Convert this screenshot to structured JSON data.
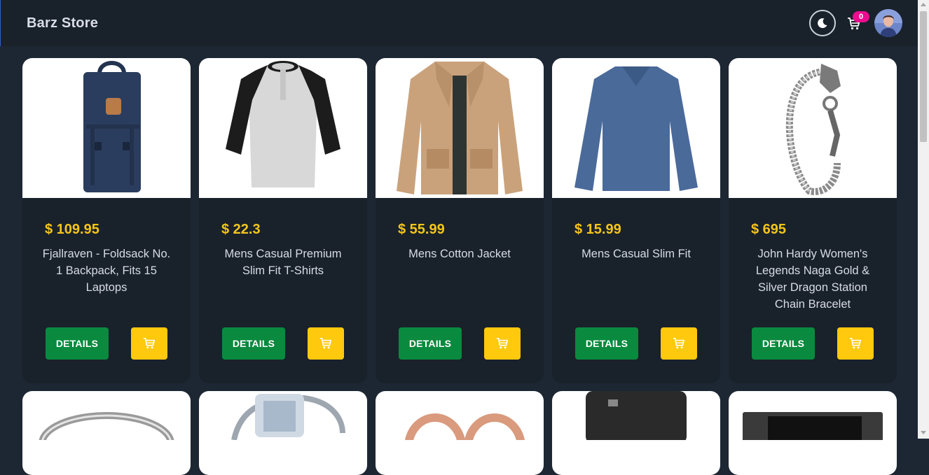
{
  "header": {
    "brand": "Barz Store",
    "cart_count": "0",
    "theme_icon": "moon-icon",
    "cart_icon": "cart-icon"
  },
  "colors": {
    "page_bg": "#1d2733",
    "card_bg": "#19212b",
    "price": "#f5c518",
    "details_button": "#0a8a3e",
    "cart_button": "#ffc90d",
    "badge": "#ec0c8e"
  },
  "products": [
    {
      "price": "$ 109.95",
      "title": "Fjallraven - Foldsack No. 1 Backpack, Fits 15 Laptops",
      "details_label": "DETAILS",
      "image": "backpack"
    },
    {
      "price": "$ 22.3",
      "title": "Mens Casual Premium Slim Fit T-Shirts",
      "details_label": "DETAILS",
      "image": "raglan-shirt"
    },
    {
      "price": "$ 55.99",
      "title": "Mens Cotton Jacket",
      "details_label": "DETAILS",
      "image": "jacket"
    },
    {
      "price": "$ 15.99",
      "title": "Mens Casual Slim Fit",
      "details_label": "DETAILS",
      "image": "long-sleeve-shirt"
    },
    {
      "price": "$ 695",
      "title": "John Hardy Women's Legends Naga Gold & Silver Dragon Station Chain Bracelet",
      "details_label": "DETAILS",
      "image": "bracelet"
    }
  ],
  "second_row_images": [
    "ring",
    "diamond-ring",
    "earrings",
    "hard-drive",
    "ssd"
  ]
}
